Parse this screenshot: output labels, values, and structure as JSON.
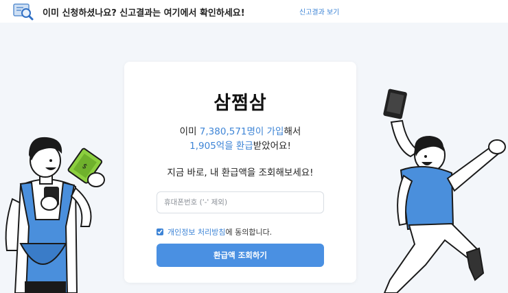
{
  "banner": {
    "icon": "document-search-icon",
    "text": "이미 신청하셨나요? 신고결과는 여기에서 확인하세요!",
    "link": "신고결과 보기"
  },
  "card": {
    "brand": "삼쩜삼",
    "stats_line1_prefix": "이미 ",
    "stats_users": "7,380,571명이 가입",
    "stats_line1_suffix": "해서",
    "stats_refund": "1,905억을 환급",
    "stats_line2_suffix": "받았어요!",
    "cta": "지금 바로, 내 환급액을 조회해보세요!",
    "phone_placeholder": "휴대폰번호 ('-' 제외)",
    "agree_link": "개인정보 처리방침",
    "agree_suffix": "에 동의합니다.",
    "agree_checked": true,
    "submit": "환급액 조회하기"
  },
  "illustrations": {
    "left": "man-holding-money-and-phone",
    "right": "man-jumping-with-phone"
  },
  "colors": {
    "accent": "#4a90e2",
    "link": "#3d84d6",
    "background": "#f3f6fa"
  }
}
